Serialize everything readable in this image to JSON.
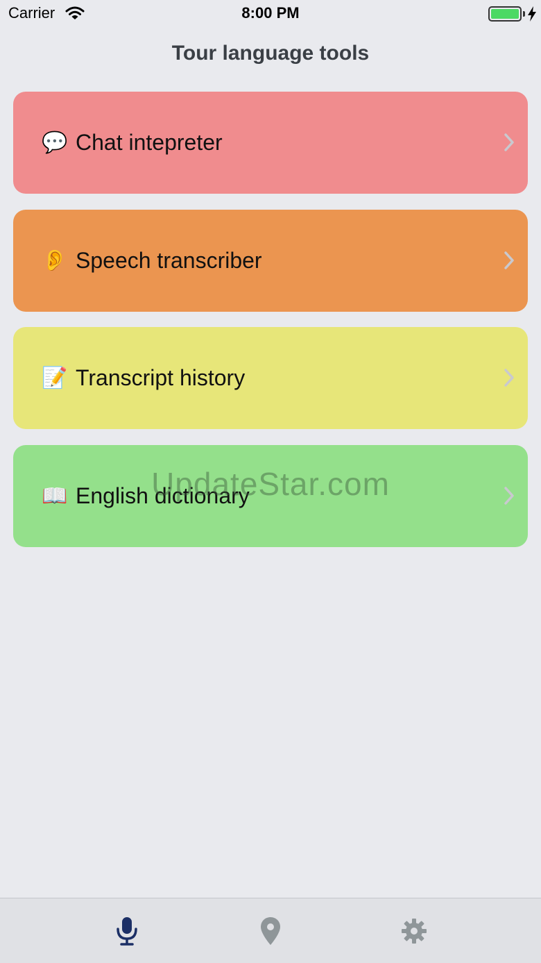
{
  "status_bar": {
    "carrier": "Carrier",
    "time": "8:00 PM",
    "icons": [
      "wifi-icon",
      "battery-icon",
      "charging-bolt-icon"
    ],
    "battery_color": "#4cd964"
  },
  "header": {
    "title": "Tour language tools"
  },
  "menu": {
    "items": [
      {
        "emoji": "💬",
        "icon": "speech-bubble-icon",
        "label": "Chat intepreter",
        "color": "#f08c8e"
      },
      {
        "emoji": "👂",
        "icon": "ear-icon",
        "label": "Speech transcriber",
        "color": "#eb9550"
      },
      {
        "emoji": "📝",
        "icon": "memo-icon",
        "label": "Transcript history",
        "color": "#e7e679"
      },
      {
        "emoji": "📖",
        "icon": "open-book-icon",
        "label": "English dictionary",
        "color": "#94e08b"
      }
    ]
  },
  "watermark": "UpdateStar.com",
  "tab_bar": {
    "tabs": [
      {
        "icon": "microphone-icon",
        "active": true,
        "color": "#1c2f66"
      },
      {
        "icon": "location-pin-icon",
        "active": false,
        "color": "#8f9699"
      },
      {
        "icon": "gear-icon",
        "active": false,
        "color": "#8f9699"
      }
    ]
  }
}
